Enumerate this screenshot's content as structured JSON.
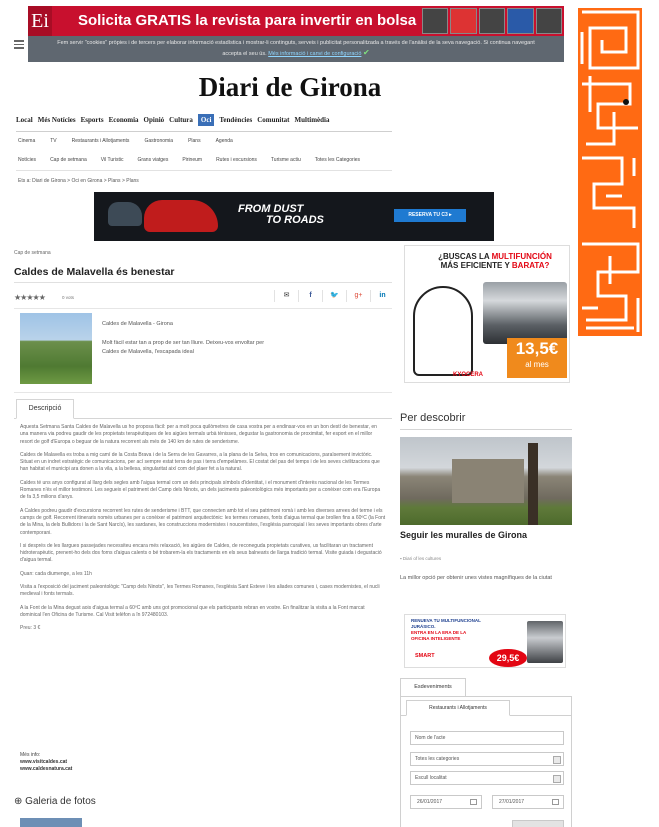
{
  "top_ad": {
    "logo": "Ei",
    "headline": "Solicita GRATIS la revista para invertir en bolsa"
  },
  "cookie_bar": {
    "text": "Fem servir \"cookies\" pròpies i de tercers per elaborar informació estadística i mostrar-li continguts, serveis i publicitat personalitzada a través de l'anàlisi de la seva navegació. Si continua navegant accepta el seu ús.",
    "link": "Més informació i canvi de configuració",
    "check": "✔"
  },
  "site_title": "Diari de Girona",
  "main_nav": [
    "Local",
    "Més Notícies",
    "Esports",
    "Economia",
    "Opinió",
    "Cultura",
    "Oci",
    "Tendències",
    "Comunitat",
    "Multimèdia"
  ],
  "main_nav_active": "Oci",
  "sub_nav_1": [
    "Cinema",
    "TV",
    "Restaurants i Allotjaments",
    "Gastronomia",
    "Plans",
    "Agenda"
  ],
  "sub_nav_2": [
    "Notícies",
    "Cap de setmana",
    "Vil Turistic",
    "Grans viatges",
    "Pirineum",
    "Rutes i excursions",
    "Turisme actiu",
    "Totes les Categories"
  ],
  "breadcrumb": "Ets a: Diari de Girona > Oci en Girona > Plans > Plans",
  "mid_ad": {
    "slogan_1": "FROM DUST",
    "slogan_2": "TO ROADS",
    "cta": "RESERVA TU C3 ▸"
  },
  "article": {
    "kicker": "Cap de setmana",
    "title": "Caldes de Malavella és benestar",
    "stars": "★★★★★",
    "votes": "0 vots",
    "social": {
      "email": "✉",
      "facebook": "f",
      "twitter": "🐦",
      "gplus": "g+",
      "linkedin": "in"
    },
    "lead_place": "Caldes de Malavella - Girona",
    "lead_text": "Molt fàcil estar tan a prop de ser tan lliure. Deixeu-vos envoltar per Caldes de Malavella, l'escapada ideal",
    "tab": "Descripció",
    "body": [
      "Aquesta Setmana Santa Caldes de Malavella us ho proposa fàcil: per a molt poca quilòmetres de casa vostra per a endinsar-vos en un bon destí de benestar, en una manera via podreu gaudir de les propietats terapèutiques de les aigües termals urbà tènisses, degustar la gastronomia de proximitat, fer esport en el millor resort de golf d'Europa o beguar de la natura recorrent als més de 140 km de rutes de senderisme.",
      "Caldes de Malavella es troba a mig camí de la Costa Brava i de la Serra de les Gavarres, a la plana de la Selva, tros en comunicacions, paraïsement invictòric. Situat en un indret estratègic de comunicacions, per ací sempre estat terra de pas i terra d'empelàmes. El costat del pas del temps i de les seves civilitzacions que han habitat el municipi ara donen a la vila, a la bellesa, singularitat així com del plaer fet a la natural.",
      "Caldes té uns anys configurat al llarg dels segles amb l'aigua termal com un dels principals símbols d'identitat, i el monument d'interès nacional de les Termes Romanes n'és el millor testimoni. Les segueix el patriment del Camp dels Ninots, un dels jaciments paleontològics més importants per a conèixer com era l'Europa de fa 3,5 milions d'anys.",
      "A Caldes podreu gaudir d'excursions recorrent les rutes de senderisme i BTT, que connecten amb tot el seu patrimoni romà i amb les diverses arrees del terme i els camps de golf. Recorrent itineraris només urbanes per a conèixer el patrimoni arquitectònic: les termes romanes, fonts d'aigua termal que brollen fins a 60ºC (la Font de la Mina, la dels Bullidors i la de Sant Narcís), les sardanes, les construccions modernistes i noucentistes, l'església parroquial i les seves importants obres d'arte contemporani.",
      "I si després de les llargues passejades necessiteu encara més relaxació, les aigües de Caldes, de reconeguda propietats curatives, us facilitaran un tractament hidroterapèutic, prenent-ho dels dos forns d'aigua calents o bé trobarem-la els tractaments en els seus balnearis de llarga tradició termal. Visite guiada i degustació d'aigua termal.",
      "Quan: cada diumenge, a les 11h",
      "Visita a l'exposició del jaciment paleontològic \"Camp dels Ninots\", les Termes Romanes, l'església Sant Esteve i les aliades comunes i, cases modernistes, el nucli medieval i fonts termals.",
      "A la Font de la Mina degust aois d'aigua termal a 60ºC amb uns got promocional que els participants rebran en vostre. En finalitzar la visita a la Font marcat dominical l'en Oficina de Turisme. Cal Visit telèfon a în 972480103.",
      "Preu: 3 €"
    ],
    "more_info_label": "Més info:",
    "links": [
      "www.visitcaldes.cat",
      "www.caldesnatura.cat"
    ]
  },
  "gallery_title": "Galeria de fotos",
  "right_ad": {
    "line1": "¿BUSCAS LA",
    "line1_red": "MULTIFUNCIÓN",
    "line2": "MÁS EFICIENTE Y",
    "line2_red": "BARATA?",
    "price": "13,5€",
    "price_sub": "al mes",
    "brand": "KYOCERA"
  },
  "discover": {
    "title": "Per descobrir",
    "caption": "Seguir les muralles de Girona",
    "meta": "Diari of les cultures",
    "text": "La millor opció per obtenir unes vistes magnífiques de la ciutat"
  },
  "right_ad2": {
    "line1": "RENUEVA TU MULTIFUNCIONAL JURÁSICO.",
    "line2_red": "ENTRA EN LA ERA DE LA",
    "line3_red": "OFICINA INTELIGENTE",
    "brand": "SMART",
    "price": "29,5€"
  },
  "widget": {
    "tab_active": "Esdeveniments",
    "tab_sub": "Restaurants i Allotjaments",
    "name_placeholder": "Nom de l'acte",
    "category_select": "Totes les categories",
    "location_select": "Escull localitat",
    "date_from": "26/01/2017",
    "date_to": "27/01/2017"
  },
  "colors": {
    "brand_blue": "#3a6fb7",
    "top_ad_red": "#c8102e",
    "maze_orange": "#ff6a13"
  }
}
